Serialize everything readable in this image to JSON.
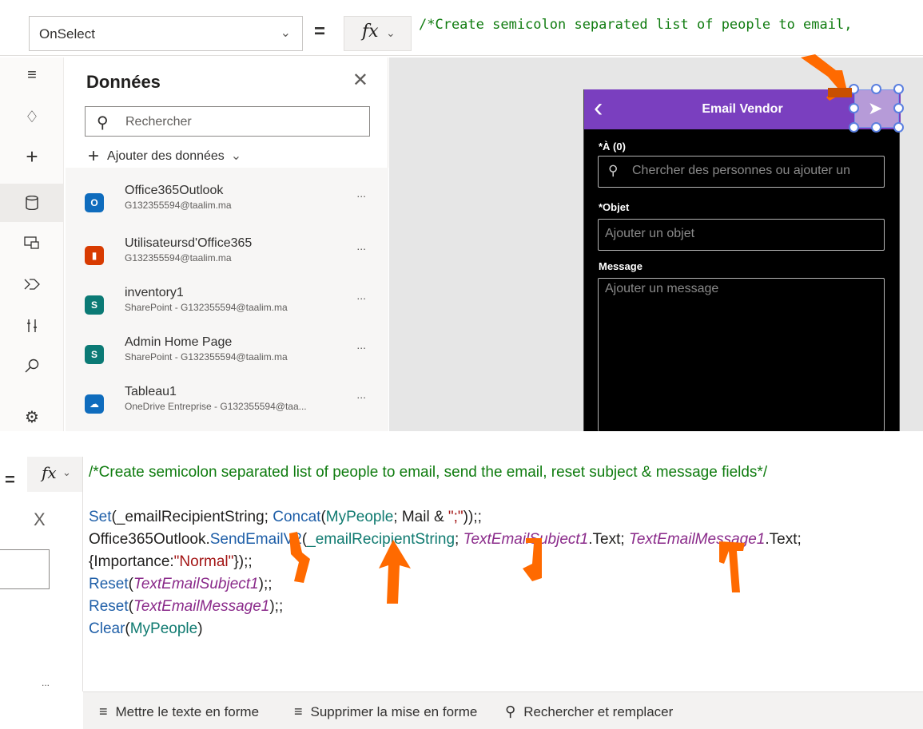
{
  "formula_bar": {
    "property": "OnSelect",
    "equals": "=",
    "fx_label": "fx",
    "formula_text": "/*Create semicolon separated list of people to email,"
  },
  "data_panel": {
    "title": "Données",
    "search_placeholder": "Rechercher",
    "add_data_label": "Ajouter des données",
    "items": [
      {
        "name": "Office365Outlook",
        "sub": "G132355594@taalim.ma",
        "icon": "outlook-icon",
        "color": "#0f6cbd"
      },
      {
        "name": "Utilisateursd'Office365",
        "sub": "G132355594@taalim.ma",
        "icon": "office-icon",
        "color": "#d83b01"
      },
      {
        "name": "inventory1",
        "sub": "SharePoint - G132355594@taalim.ma",
        "icon": "sharepoint-icon",
        "color": "#0b7a75"
      },
      {
        "name": "Admin Home Page",
        "sub": "SharePoint - G132355594@taalim.ma",
        "icon": "sharepoint-icon",
        "color": "#0b7a75"
      },
      {
        "name": "Tableau1",
        "sub": "OneDrive Entreprise - G132355594@taa...",
        "icon": "onedrive-icon",
        "color": "#0f6cbd"
      }
    ],
    "more_label": "..."
  },
  "phone": {
    "title": "Email Vendor",
    "to_label": "*À (0)",
    "to_placeholder": "Chercher des personnes ou ajouter un",
    "subject_label": "*Objet",
    "subject_placeholder": "Ajouter un objet",
    "message_label": "Message",
    "message_placeholder": "Ajouter un message",
    "header_color": "#7a3fbf"
  },
  "code": {
    "line1": "/*Create semicolon separated list of people to email, send the email, reset subject & message fields*/",
    "set_fn": "Set",
    "set_args_open": "(_emailRecipientString; ",
    "concat_fn": "Concat",
    "paren_open": "(",
    "mypeople": "MyPeople",
    "mail_part": "; Mail & ",
    "str_semicolon": "\";\"",
    "set_close": "));;",
    "outlook": "Office365Outlook.",
    "sendemail": "SendEmailV2",
    "recip_open": "(",
    "recip": "_emailRecipientString",
    "semi_sep": "; ",
    "subject_ctl": "TextEmailSubject1",
    "dot_text": ".Text; ",
    "message_ctl": "TextEmailMessage1",
    "dot_text_end": ".Text;",
    "importance_open": "{Importance:",
    "str_normal": "\"Normal\"",
    "importance_close": "});;",
    "reset_fn": "Reset",
    "reset_close": ");;",
    "clear_fn": "Clear",
    "clear_close": ")"
  },
  "toolbar": {
    "format_text": "Mettre le texte en forme",
    "remove_format": "Supprimer la mise en forme",
    "find_replace": "Rechercher et remplacer"
  },
  "bottom_left": {
    "close_label": "X",
    "more_label": "..."
  },
  "colors": {
    "accent_purple": "#7a3fbf",
    "annotation_orange": "#ff6a00",
    "comment_green": "#107c10"
  }
}
